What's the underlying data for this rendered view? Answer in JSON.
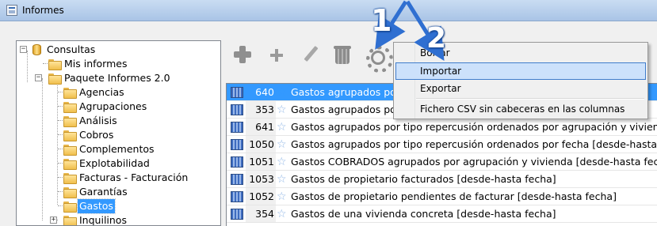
{
  "window": {
    "title": "Informes"
  },
  "tree": {
    "root": "Consultas",
    "mis_informes": "Mis informes",
    "paquete": "Paquete Informes  2.0",
    "children": [
      "Agencias",
      "Agrupaciones",
      "Análisis",
      "Cobros",
      "Complementos",
      "Explotabilidad",
      "Facturas - Facturación",
      "Garantías",
      "Gastos",
      "Inquilinos"
    ],
    "selected": "Gastos",
    "expander_collapsed": "+",
    "expander_expanded": "−"
  },
  "toolbar": {
    "icons": [
      "add-icon",
      "new-icon",
      "edit-icon",
      "delete-icon",
      "settings-icon"
    ]
  },
  "report_list": {
    "rows": [
      {
        "num": "640",
        "desc": "Gastos agrupados por",
        "selected": true
      },
      {
        "num": "353",
        "desc": "Gastos agrupados por"
      },
      {
        "num": "641",
        "desc": "Gastos agrupados por tipo repercusión ordenados por agrupación y vivienda"
      },
      {
        "num": "1050",
        "desc": "Gastos agrupados por tipo repercusión ordenados por fecha [desde-hasta fecha]"
      },
      {
        "num": "1051",
        "desc": "Gastos COBRADOS agrupados por agrupación y vivienda [desde-hasta fecha]"
      },
      {
        "num": "1053",
        "desc": "Gastos de propietario facturados [desde-hasta fecha]"
      },
      {
        "num": "1052",
        "desc": "Gastos de propietario pendientes de facturar [desde-hasta fecha]"
      },
      {
        "num": "354",
        "desc": "Gastos de una vivienda concreta [desde-hasta fecha]"
      }
    ]
  },
  "context_menu": {
    "items": [
      "Borrar",
      "Importar",
      "Exportar",
      "Fichero CSV sin cabeceras en las columnas"
    ],
    "highlighted": "Importar"
  },
  "callouts": {
    "step1": "1",
    "step2": "2"
  }
}
